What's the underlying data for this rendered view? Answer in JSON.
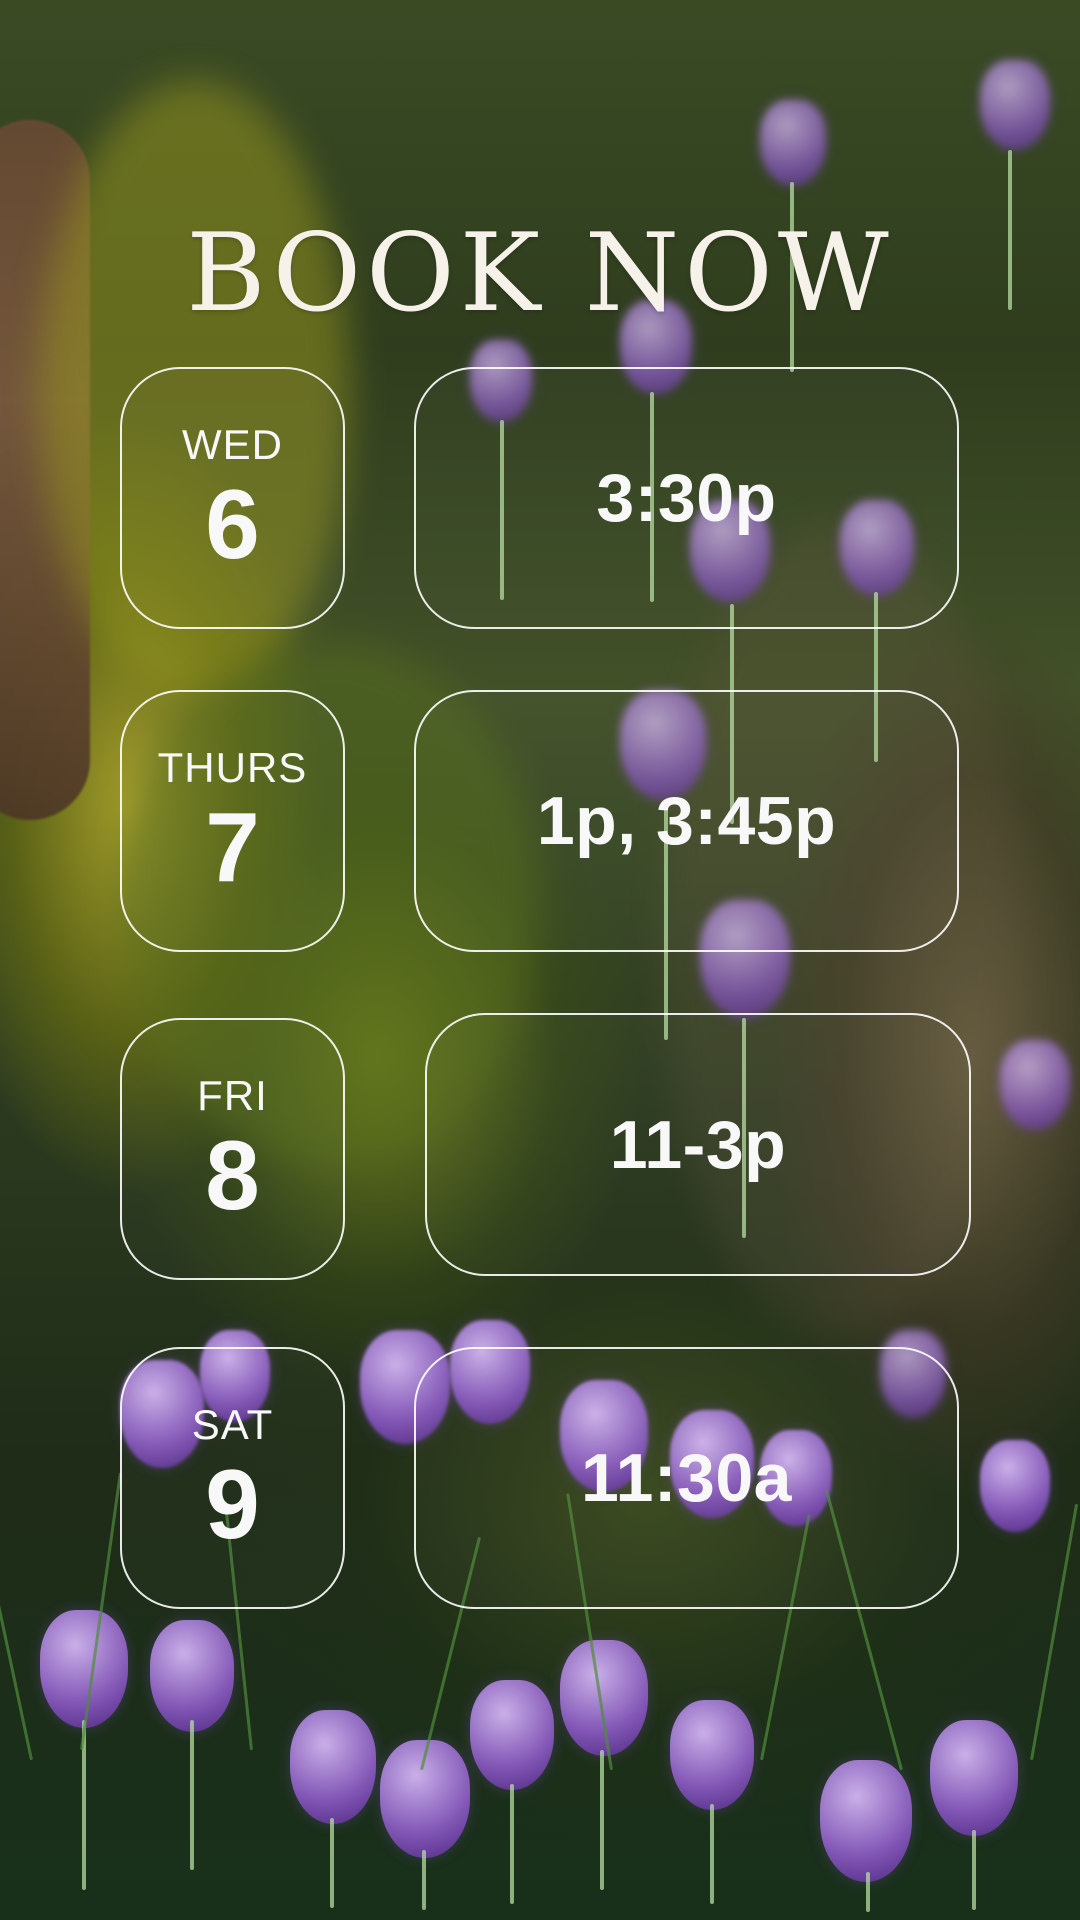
{
  "title": "BOOK NOW",
  "schedule": [
    {
      "day": "WED",
      "date": "6",
      "times": "3:30p"
    },
    {
      "day": "THURS",
      "date": "7",
      "times": "1p, 3:45p"
    },
    {
      "day": "FRI",
      "date": "8",
      "times": "11-3p"
    },
    {
      "day": "SAT",
      "date": "9",
      "times": "11:30a"
    }
  ],
  "colors": {
    "text": "#F8F8F8",
    "title": "#F6F1E9",
    "card_border": "#FFFFFF"
  },
  "background": {
    "type": "photo",
    "subject": "purple crocus flowers near mossy tree roots"
  }
}
